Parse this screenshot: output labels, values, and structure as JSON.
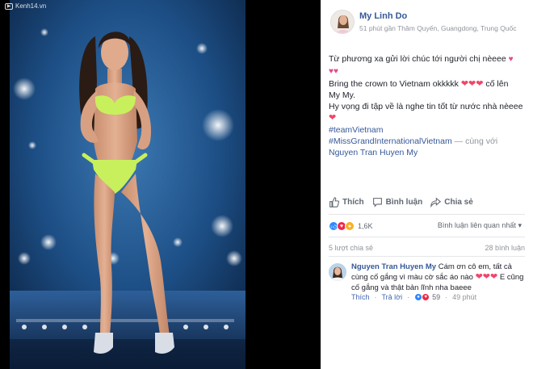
{
  "photo": {
    "watermark": "Kenh14.vn",
    "alt": "contestant on stage"
  },
  "post": {
    "author": "My Linh Do",
    "meta": "51 phút gần Thâm Quyến, Guangdong, Trung Quốc",
    "lines": {
      "l1": "Từ phương xa gửi lời chúc tới người chị nèeee",
      "l3a": "Bring the crown to Vietnam okkkkk",
      "l3b": "cố lên",
      "l4": "My My.",
      "l5": "Hy vọng đi tập về là nghe tin tốt từ nước nhà nèeee",
      "h1": "#teamVietnam",
      "h2": "#MissGrandInternationalVietnam",
      "with": " — cùng với",
      "tagged": "Nguyen Tran Huyen My"
    }
  },
  "actions": {
    "like": "Thích",
    "comment": "Bình luận",
    "share": "Chia sẻ"
  },
  "reactions": {
    "count": "1,6K",
    "sort_label": "Bình luận liên quan nhất"
  },
  "stats": {
    "shares": "5 lượt chia sẻ",
    "comments": "28 bình luận"
  },
  "comment": {
    "name": "Nguyen Tran Huyen My",
    "text_a": "Cám ơn cô em, tất cả",
    "text_b": "cùng cố gắng vì màu cờ sắc áo nào",
    "text_c": "E",
    "text_d": "cũng cố gắng và thật bản lĩnh nha baeee",
    "like_label": "Thích",
    "reply_label": "Trả lời",
    "react_count": "59",
    "time": "49 phút"
  },
  "colors": {
    "link": "#365899",
    "meta": "#90949c",
    "heart": "#f0466a",
    "like_blue": "#2d88ff",
    "stage_blue": "#1c3f6e"
  }
}
